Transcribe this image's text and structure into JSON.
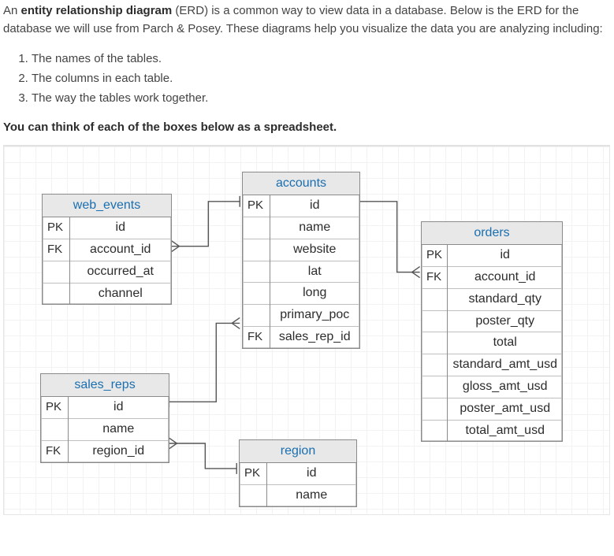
{
  "intro": {
    "prefix": "An ",
    "bold": "entity relationship diagram",
    "suffix": " (ERD) is a common way to view data in a database. Below is the ERD for the database we will use from Parch & Posey. These diagrams help you visualize the data you are analyzing including:"
  },
  "list": {
    "item1": "The names of the tables.",
    "item2": "The columns in each table.",
    "item3": "The way the tables work together."
  },
  "boldline": "You can think of each of the boxes below as a spreadsheet.",
  "tables": {
    "web_events": {
      "title": "web_events",
      "r0k": "PK",
      "r0c": "id",
      "r1k": "FK",
      "r1c": "account_id",
      "r2k": "",
      "r2c": "occurred_at",
      "r3k": "",
      "r3c": "channel"
    },
    "accounts": {
      "title": "accounts",
      "r0k": "PK",
      "r0c": "id",
      "r1k": "",
      "r1c": "name",
      "r2k": "",
      "r2c": "website",
      "r3k": "",
      "r3c": "lat",
      "r4k": "",
      "r4c": "long",
      "r5k": "",
      "r5c": "primary_poc",
      "r6k": "FK",
      "r6c": "sales_rep_id"
    },
    "orders": {
      "title": "orders",
      "r0k": "PK",
      "r0c": "id",
      "r1k": "FK",
      "r1c": "account_id",
      "r2k": "",
      "r2c": "standard_qty",
      "r3k": "",
      "r3c": "poster_qty",
      "r4k": "",
      "r4c": "total",
      "r5k": "",
      "r5c": "standard_amt_usd",
      "r6k": "",
      "r6c": "gloss_amt_usd",
      "r7k": "",
      "r7c": "poster_amt_usd",
      "r8k": "",
      "r8c": "total_amt_usd"
    },
    "sales_reps": {
      "title": "sales_reps",
      "r0k": "PK",
      "r0c": "id",
      "r1k": "",
      "r1c": "name",
      "r2k": "FK",
      "r2c": "region_id"
    },
    "region": {
      "title": "region",
      "r0k": "PK",
      "r0c": "id",
      "r1k": "",
      "r1c": "name"
    }
  }
}
